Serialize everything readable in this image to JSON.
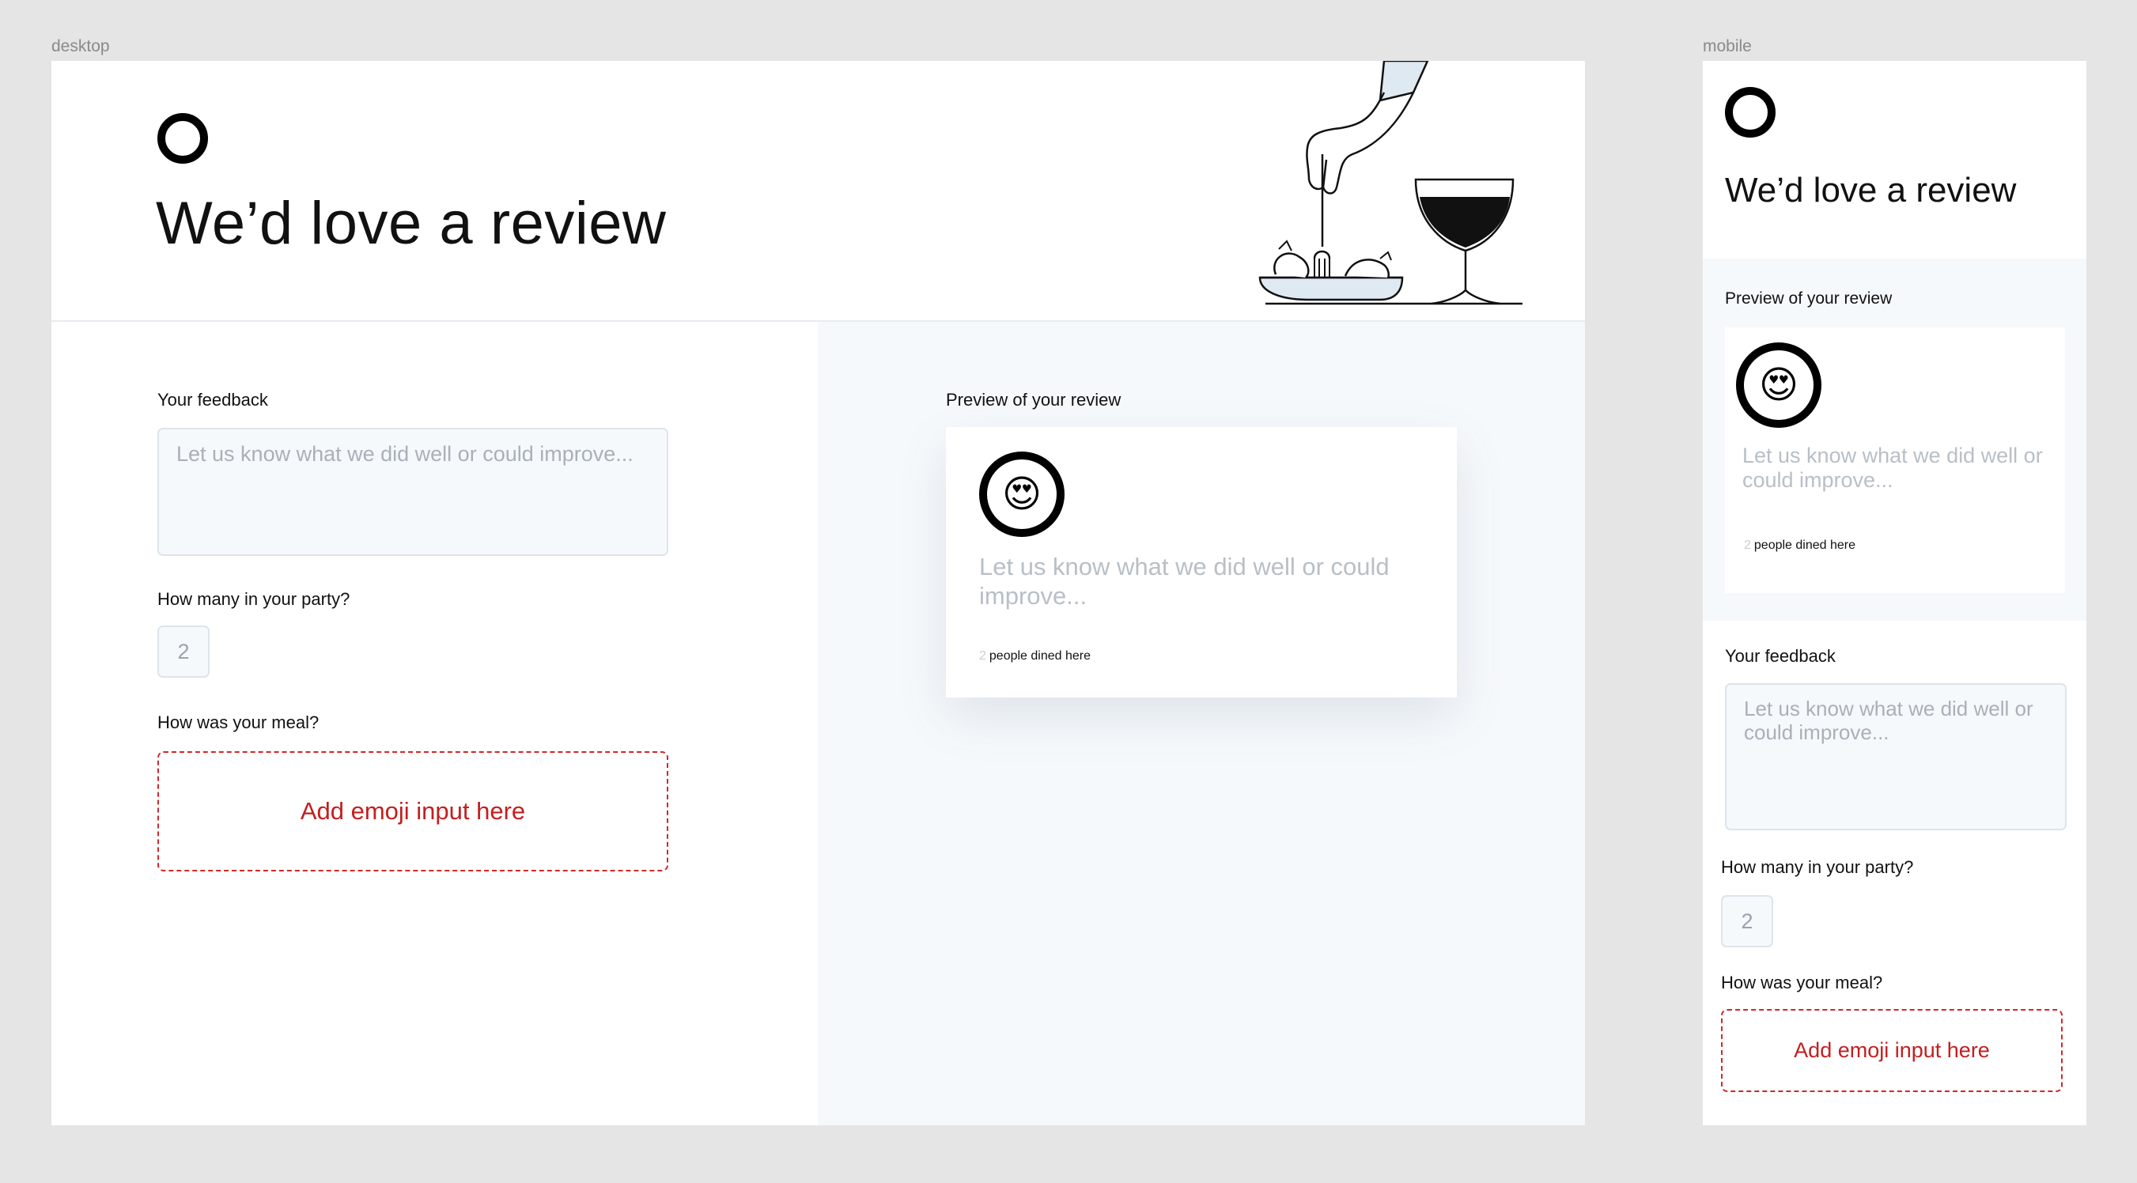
{
  "frames": {
    "desktop_label": "desktop",
    "mobile_label": "mobile"
  },
  "desktop": {
    "title": "We’d love a review",
    "form": {
      "feedback_label": "Your feedback",
      "feedback_placeholder": "Let us know what we did well or could improve...",
      "party_label": "How many in your party?",
      "party_value": "2",
      "meal_label": "How was your meal?",
      "emoji_placeholder": "Add emoji input here"
    },
    "preview": {
      "label": "Preview of your review",
      "emoji": "😍",
      "text": "Let us know what we did well or could improve...",
      "party_count": "2",
      "dined_text": "people dined here"
    }
  },
  "mobile": {
    "title": "We’d love a review",
    "preview": {
      "label": "Preview of your review",
      "emoji": "😍",
      "text": "Let us know what we did well or could improve...",
      "party_count": "2",
      "dined_text": "people dined here"
    },
    "form": {
      "feedback_label": "Your feedback",
      "feedback_placeholder": "Let us know what we did well or could improve...",
      "party_label": "How many in your party?",
      "party_value": "2",
      "meal_label": "How was your meal?",
      "emoji_placeholder": "Add emoji input here"
    }
  },
  "icons": {
    "logo": "ring-logo-icon",
    "illustration": "dining-illustration-icon"
  },
  "colors": {
    "page_bg": "#e5e5e5",
    "panel_bg": "#f6f9fc",
    "accent_red": "#c31f1f",
    "placeholder_grey": "#a9b0b8"
  }
}
